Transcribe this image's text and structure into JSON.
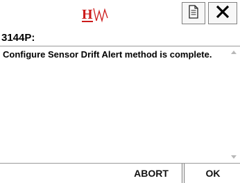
{
  "header": {
    "logo_icon": "hw-logo-icon",
    "doc_button_icon": "document-icon",
    "close_button_icon": "close-icon"
  },
  "dialog": {
    "title": "3144P:",
    "message": "Configure Sensor Drift Alert method is complete."
  },
  "footer": {
    "abort_label": "ABORT",
    "ok_label": "OK"
  },
  "colors": {
    "logo_red": "#cc1b1b",
    "border": "#808080"
  }
}
